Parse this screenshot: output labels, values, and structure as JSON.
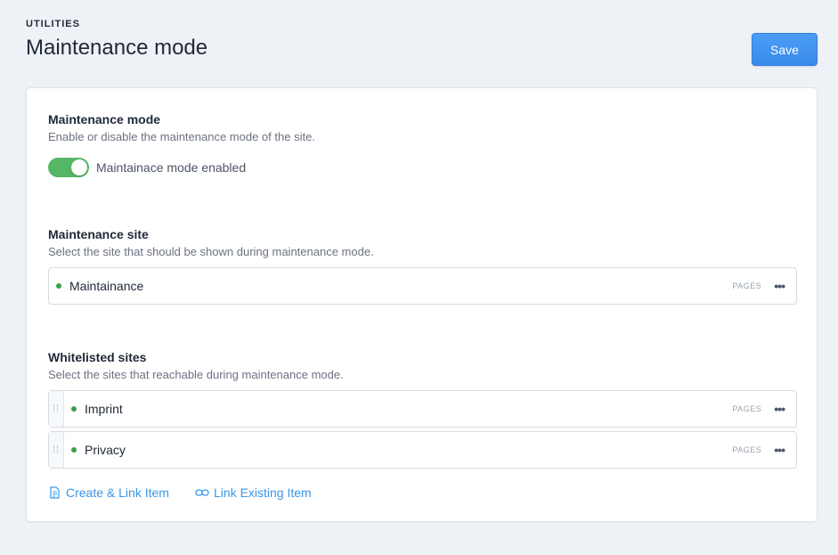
{
  "header": {
    "eyebrow": "UTILITIES",
    "title": "Maintenance mode",
    "save_label": "Save"
  },
  "maintenance_mode": {
    "title": "Maintenance mode",
    "description": "Enable or disable the maintenance mode of the site.",
    "toggle_on": true,
    "toggle_label": "Maintainace mode enabled"
  },
  "maintenance_site": {
    "title": "Maintenance site",
    "description": "Select the site that should be shown during maintenance mode.",
    "item": {
      "name": "Maintainance",
      "tag": "PAGES",
      "more": "•••"
    }
  },
  "whitelisted": {
    "title": "Whitelisted sites",
    "description": "Select the sites that reachable during maintenance mode.",
    "items": [
      {
        "name": "Imprint",
        "tag": "PAGES",
        "more": "•••"
      },
      {
        "name": "Privacy",
        "tag": "PAGES",
        "more": "•••"
      }
    ],
    "create_link": "Create & Link Item",
    "link_existing": "Link Existing Item"
  },
  "colors": {
    "accent": "#3b96e8",
    "toggle_on": "#55b766",
    "status_dot": "#3aa14b",
    "background": "#eef1f5"
  }
}
